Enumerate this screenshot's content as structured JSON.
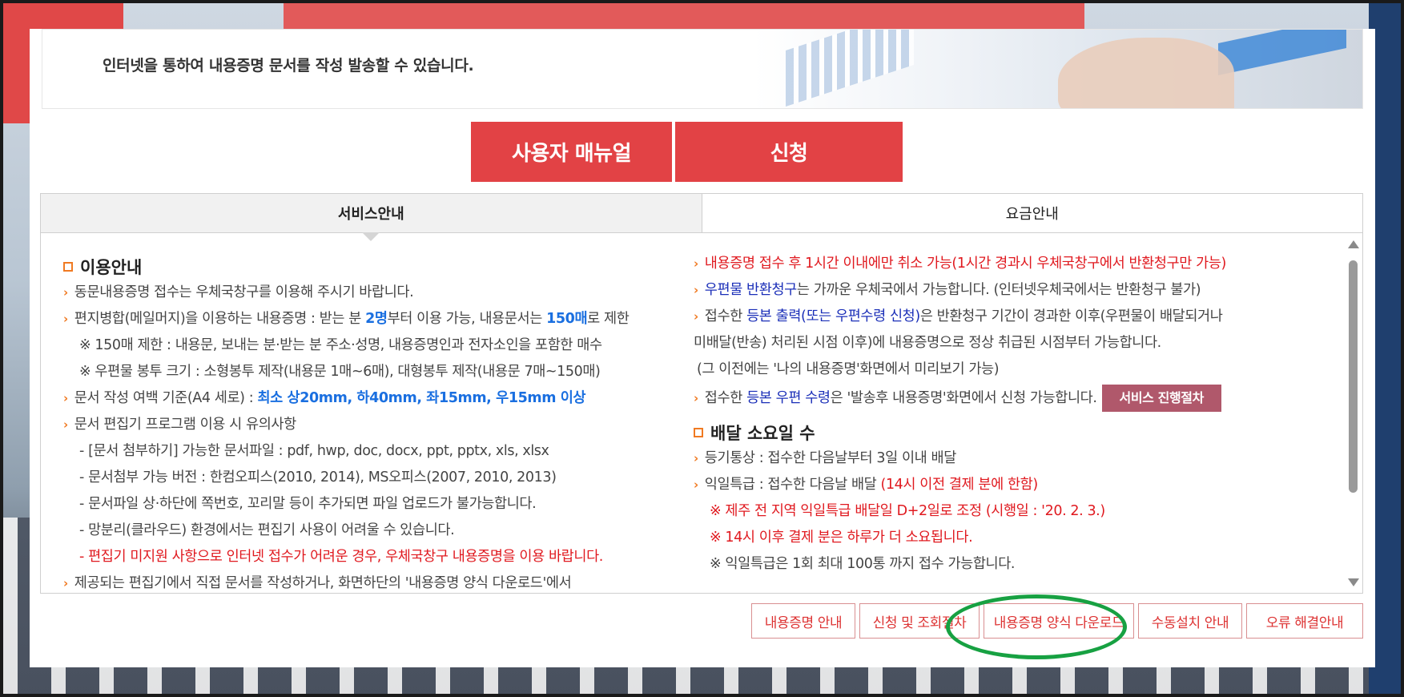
{
  "banner": {
    "text": "인터넷을 통하여 내용증명 문서를 작성 발송할 수 있습니다."
  },
  "buttons": {
    "manual": "사용자 매뉴얼",
    "apply": "신청"
  },
  "tabs": [
    {
      "label": "서비스안내",
      "active": true
    },
    {
      "label": "요금안내",
      "active": false
    }
  ],
  "left": {
    "section_title": "이용안내",
    "l1": "동문내용증명 접수는 우체국창구를 이용해 주시기 바랍니다.",
    "l2_a": "편지병합(메일머지)을 이용하는 내용증명 : 받는 분 ",
    "l2_b": "2명",
    "l2_c": "부터 이용 가능, 내용문서는 ",
    "l2_d": "150매",
    "l2_e": "로 제한",
    "l3": "※ 150매 제한 : 내용문, 보내는 분·받는 분 주소·성명, 내용증명인과 전자소인을 포함한 매수",
    "l4": "※ 우편물 봉투 크기 : 소형봉투 제작(내용문 1매~6매), 대형봉투 제작(내용문 7매~150매)",
    "l5_a": "문서 작성 여백 기준(A4 세로) : ",
    "l5_b": "최소 상20mm, 하40mm, 좌15mm, 우15mm 이상",
    "l6": "문서 편집기 프로그램 이용 시 유의사항",
    "l7": "- [문서 첨부하기] 가능한 문서파일 : pdf, hwp, doc, docx, ppt, pptx, xls, xlsx",
    "l8": "- 문서첨부 가능 버전 : 한컴오피스(2010, 2014), MS오피스(2007, 2010, 2013)",
    "l9": "- 문서파일 상·하단에 쪽번호, 꼬리말 등이 추가되면 파일 업로드가 불가능합니다.",
    "l10": "- 망분리(클라우드) 환경에서는 편집기 사용이 어려울 수 있습니다.",
    "l11": "- 편집기 미지원 사항으로 인터넷 접수가 어려운 경우, 우체국창구 내용증명을 이용 바랍니다.",
    "l12": "제공되는 편집기에서 직접 문서를 작성하거나, 화면하단의 '내용증명 양식 다운로드'에서"
  },
  "right": {
    "r1": "내용증명 접수 후 1시간 이내에만 취소 가능(1시간 경과시 우체국창구에서 반환청구만 가능)",
    "r2_a": "우편물 반환청구",
    "r2_b": "는 가까운 우체국에서 가능합니다. (인터넷우체국에서는 반환청구 불가)",
    "r3_a": "접수한 ",
    "r3_b": "등본 출력(또는 우편수령 신청)",
    "r3_c": "은 반환청구 기간이 경과한 이후(우편물이 배달되거나",
    "r4": "미배달(반송) 처리된 시점 이후)에 내용증명으로 정상 취급된 시점부터 가능합니다.",
    "r5": "(그 이전에는 '나의 내용증명'화면에서 미리보기 가능)",
    "r6_a": "접수한 ",
    "r6_b": "등본 우편 수령",
    "r6_c": "은 '발송후 내용증명'화면에서 신청 가능합니다.",
    "r6_btn": "서비스 진행절차",
    "section_title": "배달 소요일 수",
    "r7": "등기통상 : 접수한 다음날부터 3일 이내 배달",
    "r8_a": "익일특급 : 접수한 다음날 배달 ",
    "r8_b": "(14시 이전 결제 분에 한함)",
    "r9": "※ 제주 전 지역 익일특급 배달일 D+2일로 조정 (시행일 : '20. 2. 3.)",
    "r10": "※ 14시 이후 결제 분은 하루가 더 소요됩니다.",
    "r11": "※ 익일특급은 1회 최대 100통 까지 접수 가능합니다."
  },
  "bottom_buttons": [
    "내용증명 안내",
    "신청 및 조회절차",
    "내용증명 양식 다운로드",
    "수동설치 안내",
    "오류 해결안내"
  ]
}
